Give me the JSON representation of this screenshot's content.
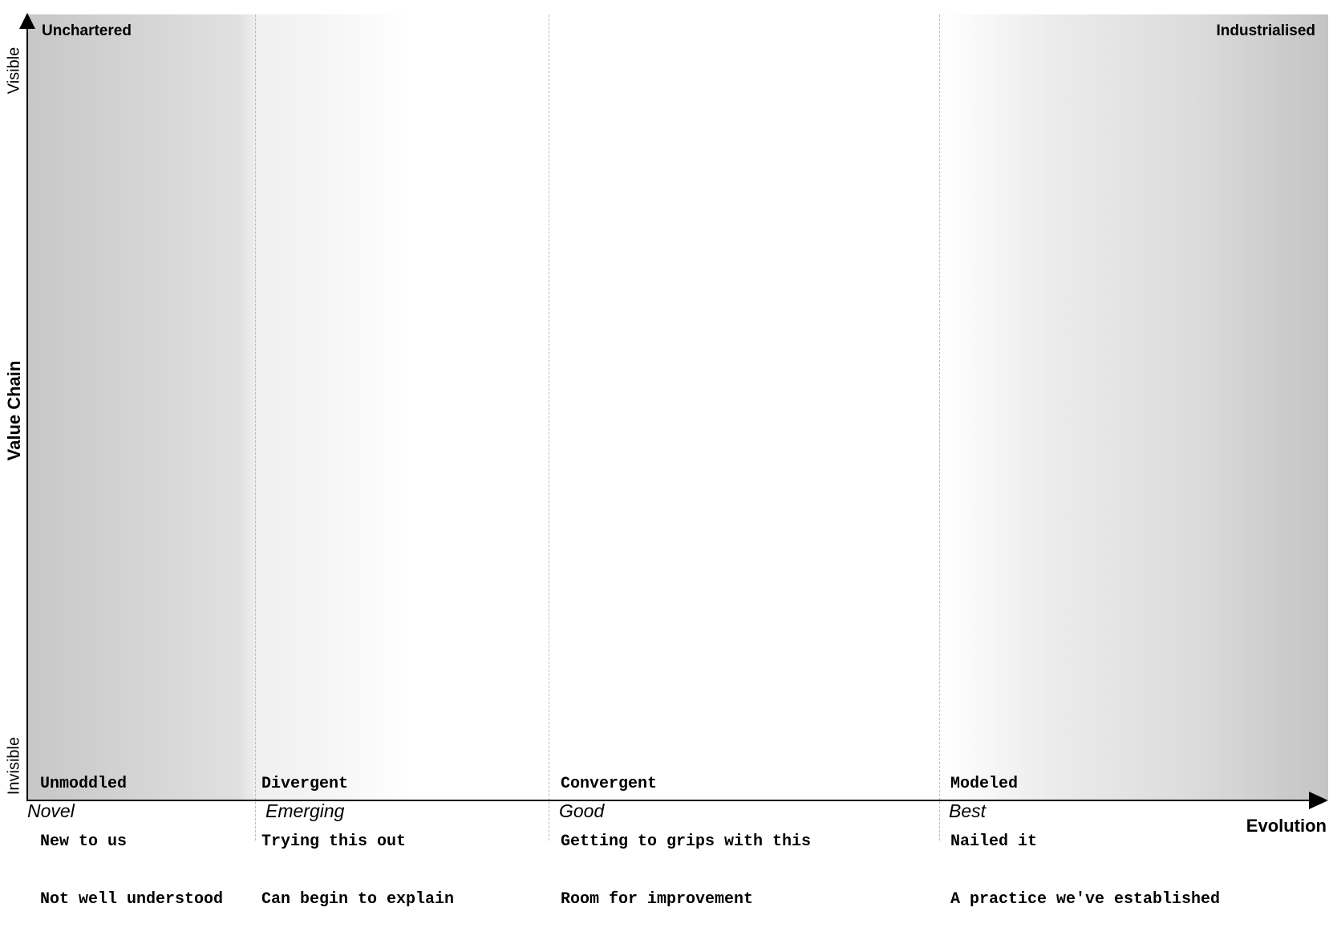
{
  "map": {
    "y_axis": {
      "title": "Value Chain",
      "top_label": "Visible",
      "bottom_label": "Invisible"
    },
    "x_axis": {
      "title": "Evolution"
    },
    "corners": {
      "left": "Unchartered",
      "right": "Industrialised"
    },
    "stages": [
      {
        "name": "Novel",
        "lines": [
          "Unmoddled",
          "New to us",
          "Not well understood"
        ]
      },
      {
        "name": "Emerging",
        "lines": [
          "Divergent",
          "Trying this out",
          "Can begin to explain"
        ]
      },
      {
        "name": "Good",
        "lines": [
          "Convergent",
          "Getting to grips with this",
          "Room for improvement"
        ]
      },
      {
        "name": "Best",
        "lines": [
          "Modeled",
          "Nailed it",
          "A practice we've established"
        ]
      }
    ]
  },
  "colors": {
    "axis": "#000000",
    "divider": "#bdbdbd",
    "shade_dark": "#c4c4c4",
    "shade_light": "#f4f4f4"
  }
}
